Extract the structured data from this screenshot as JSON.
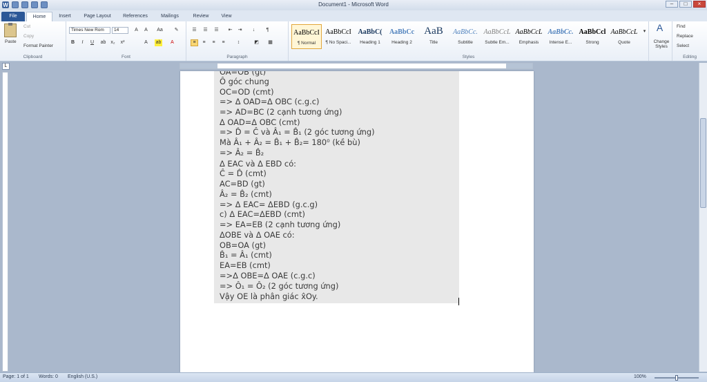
{
  "window": {
    "title": "Document1 - Microsoft Word",
    "minimize": "–",
    "maximize": "□",
    "close": "×"
  },
  "tabs": [
    "File",
    "Home",
    "Insert",
    "Page Layout",
    "References",
    "Mailings",
    "Review",
    "View"
  ],
  "clipboard": {
    "paste": "Paste",
    "cut": "Cut",
    "copy": "Copy",
    "format_painter": "Format Painter",
    "group": "Clipboard"
  },
  "font": {
    "name": "Times New Rom",
    "size": "14",
    "group": "Font"
  },
  "paragraph": {
    "group": "Paragraph"
  },
  "styles": {
    "group": "Styles",
    "items": [
      {
        "sample": "AaBbCcI",
        "name": "¶ Normal"
      },
      {
        "sample": "AaBbCcI",
        "name": "¶ No Spaci..."
      },
      {
        "sample": "AaBbC(",
        "name": "Heading 1"
      },
      {
        "sample": "AaBbCc",
        "name": "Heading 2"
      },
      {
        "sample": "AaB",
        "name": "Title"
      },
      {
        "sample": "AaBbCc.",
        "name": "Subtitle"
      },
      {
        "sample": "AaBbCcL",
        "name": "Subtle Em..."
      },
      {
        "sample": "AaBbCcL",
        "name": "Emphasis"
      },
      {
        "sample": "AaBbCc.",
        "name": "Intense E..."
      },
      {
        "sample": "AaBbCcl",
        "name": "Strong"
      },
      {
        "sample": "AaBbCcL",
        "name": "Quote"
      }
    ],
    "change": "Change Styles"
  },
  "editing": {
    "find": "Find",
    "replace": "Replace",
    "select": "Select",
    "group": "Editing"
  },
  "document": {
    "lines": [
      "OA=OB (gt)",
      "Ô góc chung",
      "OC=OD (cmt)",
      "=> Δ OAD=Δ OBC (c.g.c)",
      "=> AD=BC (2 cạnh tương ứng)",
      "Δ OAD=Δ OBC (cmt)",
      "=> D̂ = Ĉ và Â₁ = B̂₁ (2 góc tương ứng)",
      "Mà Â₁ + Â₂ = B̂₁ + B̂₂= 180⁰ (kề bù)",
      "=> Â₂ = B̂₂",
      "Δ EAC và Δ EBD có:",
      "Ĉ = D̂ (cmt)",
      "AC=BD (gt)",
      "Â₂ = B̂₂ (cmt)",
      "=> Δ EAC= ΔEBD (g.c.g)",
      "c) Δ EAC=ΔEBD (cmt)",
      "=> EA=EB (2 cạnh tương ứng)",
      "ΔOBE và Δ OAE có:",
      "OB=OA (gt)",
      "B̂₁ = Â₁ (cmt)",
      "EA=EB (cmt)",
      "=>Δ OBE=Δ OAE (c.g.c)",
      "=> Ô₁ = Ô₂ (2 góc tương ứng)",
      "Vậy OE là phân giác x̂Oy."
    ]
  },
  "status": {
    "page": "Page: 1 of 1",
    "words": "Words: 0",
    "language": "English (U.S.)",
    "zoom": "100%"
  }
}
